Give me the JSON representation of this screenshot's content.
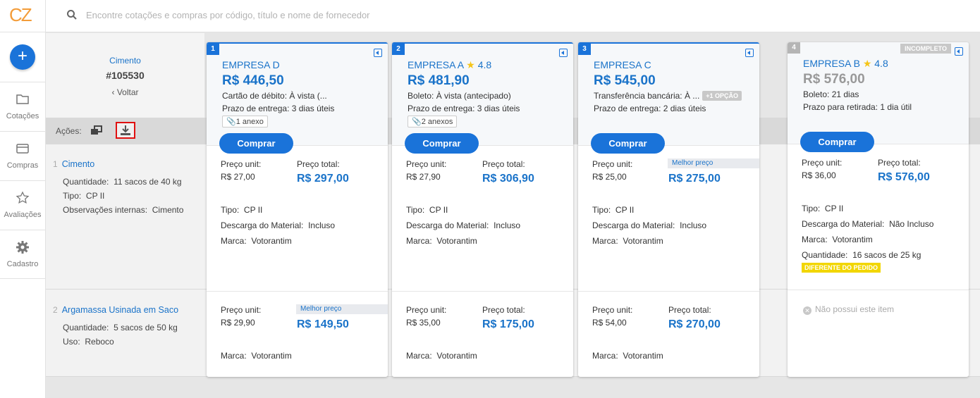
{
  "app": {
    "logo_text": "CZ"
  },
  "search": {
    "placeholder": "Encontre cotações e compras por código, título e nome de fornecedor"
  },
  "sidebar": {
    "new_button": "+",
    "items": [
      {
        "label": "Cotações",
        "icon": "folder-icon"
      },
      {
        "label": "Compras",
        "icon": "wallet-icon"
      },
      {
        "label": "Avaliações",
        "icon": "star-icon"
      },
      {
        "label": "Cadastro",
        "icon": "gear-icon"
      }
    ]
  },
  "request": {
    "title": "Cimento",
    "code": "#105530",
    "back": "‹ Voltar"
  },
  "actions": {
    "label": "Ações:"
  },
  "items": [
    {
      "num": "1",
      "name": "Cimento",
      "fields": [
        {
          "k": "Quantidade:",
          "v": "11 sacos de 40 kg"
        },
        {
          "k": "Tipo:",
          "v": "CP II"
        },
        {
          "k": "Observações internas:",
          "v": "Cimento"
        }
      ]
    },
    {
      "num": "2",
      "name": "Argamassa Usinada em Saco",
      "fields": [
        {
          "k": "Quantidade:",
          "v": "5 sacos de 50 kg"
        },
        {
          "k": "Uso:",
          "v": "Reboco"
        }
      ]
    }
  ],
  "labels": {
    "unit_price": "Preço unit:",
    "total_price": "Preço total:",
    "best_price": "Melhor preço",
    "buy": "Comprar",
    "brand": "Marca:",
    "type": "Tipo:",
    "unload": "Descarga do Material:",
    "quantity": "Quantidade:",
    "incomplete": "INCOMPLETO",
    "different": "DIFERENTE DO PEDIDO",
    "missing": "Não possui este item",
    "more_option": "+1 OPÇÃO"
  },
  "cards": [
    {
      "rank": "1",
      "company": "EMPRESA D",
      "rating": "",
      "total": "R$ 446,50",
      "payment": "Cartão de débito: À vista (...",
      "delivery": "Prazo de entrega: 3 dias úteis",
      "attachments": "1 anexo",
      "item1": {
        "unit": "R$ 27,00",
        "total": "R$ 297,00",
        "tipo": "CP II",
        "descarga": "Incluso",
        "marca": "Votorantim"
      },
      "item2": {
        "unit": "R$ 29,90",
        "total": "R$ 149,50",
        "marca": "Votorantim"
      }
    },
    {
      "rank": "2",
      "company": "EMPRESA A",
      "rating": "4.8",
      "total": "R$ 481,90",
      "payment": "Boleto: À vista (antecipado)",
      "delivery": "Prazo de entrega: 3 dias úteis",
      "attachments": "2 anexos",
      "item1": {
        "unit": "R$ 27,90",
        "total": "R$ 306,90",
        "tipo": "CP II",
        "descarga": "Incluso",
        "marca": "Votorantim"
      },
      "item2": {
        "unit": "R$ 35,00",
        "total": "R$ 175,00",
        "marca": "Votorantim"
      }
    },
    {
      "rank": "3",
      "company": "EMPRESA C",
      "rating": "",
      "total": "R$ 545,00",
      "payment": "Transferência bancária: À ...",
      "delivery": "Prazo de entrega: 2 dias úteis",
      "item1": {
        "unit": "R$ 25,00",
        "total": "R$ 275,00",
        "tipo": "CP II",
        "descarga": "Incluso",
        "marca": "Votorantim"
      },
      "item2": {
        "unit": "R$ 54,00",
        "total": "R$ 270,00",
        "marca": "Votorantim"
      }
    },
    {
      "rank": "4",
      "company": "EMPRESA B",
      "rating": "4.8",
      "total": "R$ 576,00",
      "payment": "Boleto: 21 dias",
      "delivery": "Prazo para retirada: 1 dia útil",
      "item1": {
        "unit": "R$ 36,00",
        "total": "R$ 576,00",
        "tipo": "CP II",
        "descarga": "Não Incluso",
        "marca": "Votorantim",
        "quantidade": "16 sacos de 25 kg"
      }
    }
  ],
  "colors": {
    "accent": "#1a73d9",
    "logo": "#f39c39",
    "highlight_border": "#e01010",
    "warning": "#f2d600"
  }
}
